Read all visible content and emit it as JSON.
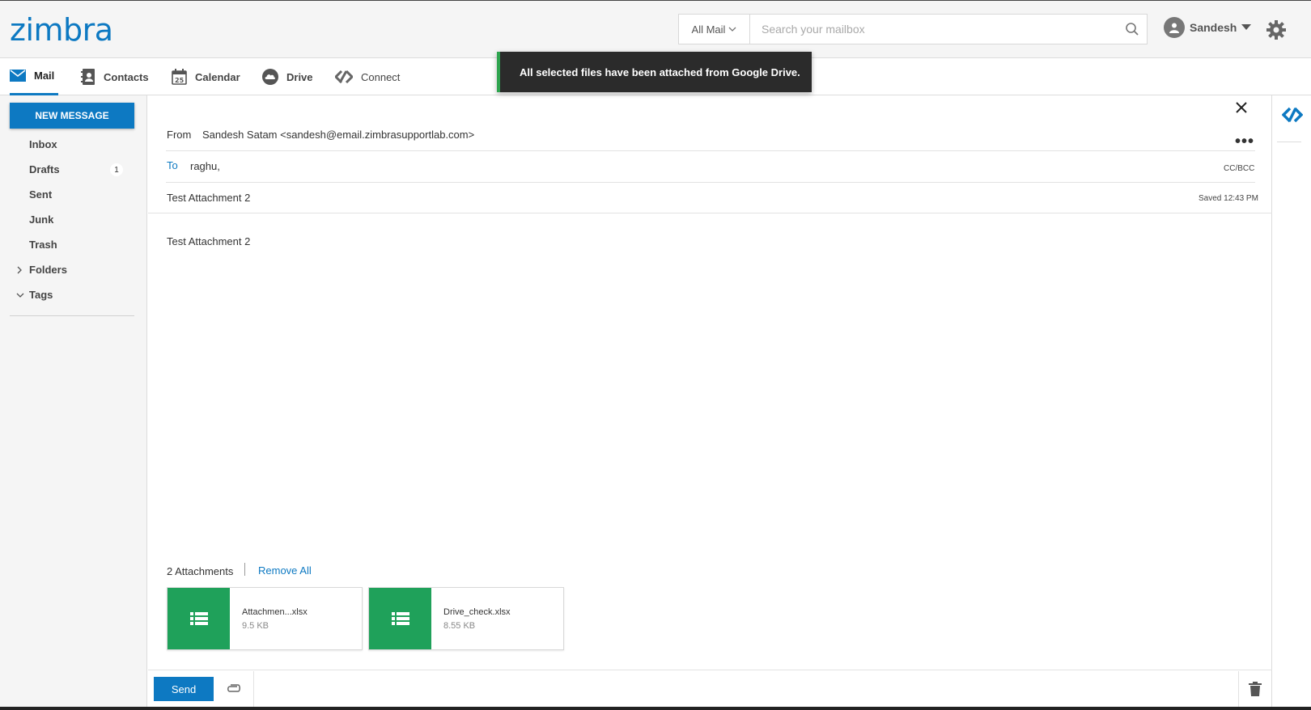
{
  "header": {
    "logo": "zimbra",
    "search_scope": "All Mail",
    "search_placeholder": "Search your mailbox",
    "user_name": "Sandesh"
  },
  "nav": {
    "tabs": [
      {
        "label": "Mail",
        "icon": "mail-icon"
      },
      {
        "label": "Contacts",
        "icon": "contacts-icon"
      },
      {
        "label": "Calendar",
        "icon": "calendar-icon"
      },
      {
        "label": "Drive",
        "icon": "cloud-icon"
      },
      {
        "label": "Connect",
        "icon": "connect-icon"
      }
    ]
  },
  "toast": {
    "message": "All selected files have been attached from Google Drive."
  },
  "sidebar": {
    "new_message": "NEW MESSAGE",
    "folders": [
      {
        "label": "Inbox"
      },
      {
        "label": "Drafts",
        "count": "1"
      },
      {
        "label": "Sent"
      },
      {
        "label": "Junk"
      },
      {
        "label": "Trash"
      },
      {
        "label": "Folders"
      },
      {
        "label": "Tags"
      }
    ]
  },
  "compose": {
    "from_label": "From",
    "from_value": "Sandesh Satam <sandesh@email.zimbrasupportlab.com>",
    "to_label": "To",
    "to_value": "raghu,",
    "cc_bcc": "CC/BCC",
    "subject": "Test Attachment 2",
    "saved_status": "Saved 12:43 PM",
    "body": "Test Attachment 2",
    "attachments_count": "2 Attachments",
    "remove_all": "Remove All",
    "attachments": [
      {
        "name": "Attachmen...xlsx",
        "size": "9.5 KB"
      },
      {
        "name": "Drive_check.xlsx",
        "size": "8.55 KB"
      }
    ],
    "send": "Send"
  },
  "colors": {
    "accent": "#0d79c2",
    "attachment_thumb": "#1fa15a",
    "toast_bg": "#2b2b2b",
    "toast_border": "#2ea44f"
  }
}
